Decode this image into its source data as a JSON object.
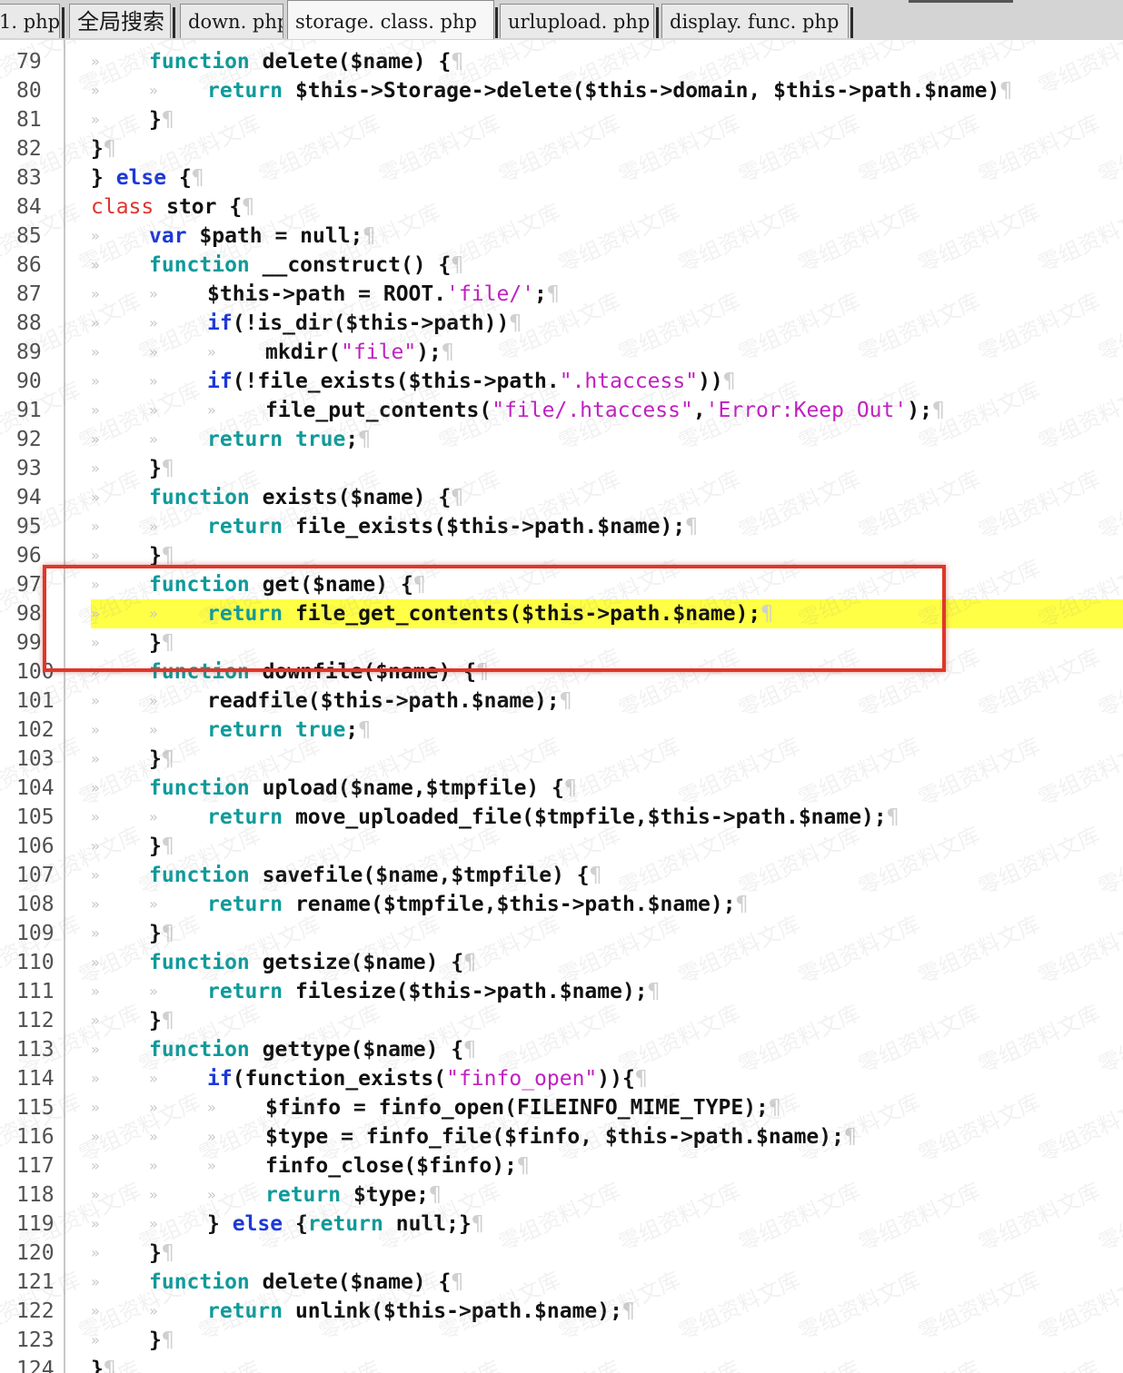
{
  "tabs": [
    {
      "label": "1. php",
      "active": false
    },
    {
      "label": "全局搜索",
      "active": false
    },
    {
      "label": "down. php",
      "active": false
    },
    {
      "label": "storage. class. php",
      "active": true
    },
    {
      "label": "urlupload. php",
      "active": false
    },
    {
      "label": "display. func. php",
      "active": false
    }
  ],
  "editor": {
    "highlighted_line": 98,
    "lines": [
      {
        "n": "79",
        "indent": 1,
        "tokens": [
          [
            "fn-kw",
            "function "
          ],
          [
            "plain",
            "delete($name) {"
          ]
        ]
      },
      {
        "n": "80",
        "indent": 2,
        "tokens": [
          [
            "fn-kw",
            "return "
          ],
          [
            "plain",
            "$this->Storage->delete($this->domain, $this->path.$name)"
          ]
        ]
      },
      {
        "n": "81",
        "indent": 1,
        "tokens": [
          [
            "plain",
            "}"
          ]
        ]
      },
      {
        "n": "82",
        "indent": 0,
        "tokens": [
          [
            "plain",
            "}"
          ]
        ]
      },
      {
        "n": "83",
        "indent": 0,
        "tokens": [
          [
            "plain",
            "} "
          ],
          [
            "kw",
            "else"
          ],
          [
            "plain",
            " {"
          ]
        ]
      },
      {
        "n": "84",
        "indent": 0,
        "tokens": [
          [
            "cls",
            "class"
          ],
          [
            "plain",
            " stor {"
          ]
        ]
      },
      {
        "n": "85",
        "indent": 1,
        "tokens": [
          [
            "kw",
            "var"
          ],
          [
            "plain",
            " $path = null;"
          ]
        ]
      },
      {
        "n": "86",
        "indent": 1,
        "tokens": [
          [
            "fn-kw",
            "function "
          ],
          [
            "plain",
            "__construct() {"
          ]
        ]
      },
      {
        "n": "87",
        "indent": 2,
        "tokens": [
          [
            "plain",
            "$this->path = ROOT."
          ],
          [
            "str",
            "'file/'"
          ],
          [
            "plain",
            ";"
          ]
        ]
      },
      {
        "n": "88",
        "indent": 2,
        "tokens": [
          [
            "kw",
            "if"
          ],
          [
            "plain",
            "(!is_dir($this->path))"
          ]
        ]
      },
      {
        "n": "89",
        "indent": 3,
        "tokens": [
          [
            "plain",
            "mkdir("
          ],
          [
            "str",
            "\"file\""
          ],
          [
            "plain",
            ");"
          ]
        ]
      },
      {
        "n": "90",
        "indent": 2,
        "tokens": [
          [
            "kw",
            "if"
          ],
          [
            "plain",
            "(!file_exists($this->path."
          ],
          [
            "str",
            "\".htaccess\""
          ],
          [
            "plain",
            "))"
          ]
        ]
      },
      {
        "n": "91",
        "indent": 3,
        "tokens": [
          [
            "plain",
            "file_put_contents("
          ],
          [
            "str",
            "\"file/.htaccess\""
          ],
          [
            "plain",
            ","
          ],
          [
            "str",
            "'Error:Keep Out'"
          ],
          [
            "plain",
            ");"
          ]
        ]
      },
      {
        "n": "92",
        "indent": 2,
        "tokens": [
          [
            "fn-kw",
            "return "
          ],
          [
            "fn-kw",
            "true"
          ],
          [
            "plain",
            ";"
          ]
        ]
      },
      {
        "n": "93",
        "indent": 1,
        "tokens": [
          [
            "plain",
            "}"
          ]
        ]
      },
      {
        "n": "94",
        "indent": 1,
        "tokens": [
          [
            "fn-kw",
            "function "
          ],
          [
            "plain",
            "exists($name) {"
          ]
        ]
      },
      {
        "n": "95",
        "indent": 2,
        "tokens": [
          [
            "fn-kw",
            "return "
          ],
          [
            "plain",
            "file_exists($this->path.$name);"
          ]
        ]
      },
      {
        "n": "96",
        "indent": 1,
        "tokens": [
          [
            "plain",
            "}"
          ]
        ]
      },
      {
        "n": "97",
        "indent": 1,
        "tokens": [
          [
            "fn-kw",
            "function "
          ],
          [
            "plain",
            "get($name) {"
          ]
        ]
      },
      {
        "n": "98",
        "indent": 2,
        "tokens": [
          [
            "fn-kw",
            "return "
          ],
          [
            "plain",
            "file_get_contents($this->path.$name);"
          ]
        ]
      },
      {
        "n": "99",
        "indent": 1,
        "tokens": [
          [
            "plain",
            "}"
          ]
        ]
      },
      {
        "n": "100",
        "indent": 1,
        "tokens": [
          [
            "fn-kw",
            "function "
          ],
          [
            "plain",
            "downfile($name) {"
          ]
        ]
      },
      {
        "n": "101",
        "indent": 2,
        "tokens": [
          [
            "plain",
            "readfile($this->path.$name);"
          ]
        ]
      },
      {
        "n": "102",
        "indent": 2,
        "tokens": [
          [
            "fn-kw",
            "return "
          ],
          [
            "fn-kw",
            "true"
          ],
          [
            "plain",
            ";"
          ]
        ]
      },
      {
        "n": "103",
        "indent": 1,
        "tokens": [
          [
            "plain",
            "}"
          ]
        ]
      },
      {
        "n": "104",
        "indent": 1,
        "tokens": [
          [
            "fn-kw",
            "function "
          ],
          [
            "plain",
            "upload($name,$tmpfile) {"
          ]
        ]
      },
      {
        "n": "105",
        "indent": 2,
        "tokens": [
          [
            "fn-kw",
            "return "
          ],
          [
            "plain",
            "move_uploaded_file($tmpfile,$this->path.$name);"
          ]
        ]
      },
      {
        "n": "106",
        "indent": 1,
        "tokens": [
          [
            "plain",
            "}"
          ]
        ]
      },
      {
        "n": "107",
        "indent": 1,
        "tokens": [
          [
            "fn-kw",
            "function "
          ],
          [
            "plain",
            "savefile($name,$tmpfile) {"
          ]
        ]
      },
      {
        "n": "108",
        "indent": 2,
        "tokens": [
          [
            "fn-kw",
            "return "
          ],
          [
            "plain",
            "rename($tmpfile,$this->path.$name);"
          ]
        ]
      },
      {
        "n": "109",
        "indent": 1,
        "tokens": [
          [
            "plain",
            "}"
          ]
        ]
      },
      {
        "n": "110",
        "indent": 1,
        "tokens": [
          [
            "fn-kw",
            "function "
          ],
          [
            "plain",
            "getsize($name) {"
          ]
        ]
      },
      {
        "n": "111",
        "indent": 2,
        "tokens": [
          [
            "fn-kw",
            "return "
          ],
          [
            "plain",
            "filesize($this->path.$name);"
          ]
        ]
      },
      {
        "n": "112",
        "indent": 1,
        "tokens": [
          [
            "plain",
            "}"
          ]
        ]
      },
      {
        "n": "113",
        "indent": 1,
        "tokens": [
          [
            "fn-kw",
            "function "
          ],
          [
            "plain",
            "gettype($name) {"
          ]
        ]
      },
      {
        "n": "114",
        "indent": 2,
        "tokens": [
          [
            "kw",
            "if"
          ],
          [
            "plain",
            "(function_exists("
          ],
          [
            "str",
            "\"finfo_open\""
          ],
          [
            "plain",
            ")){"
          ]
        ]
      },
      {
        "n": "115",
        "indent": 3,
        "tokens": [
          [
            "plain",
            "$finfo = finfo_open(FILEINFO_MIME_TYPE);"
          ]
        ]
      },
      {
        "n": "116",
        "indent": 3,
        "tokens": [
          [
            "plain",
            "$type = finfo_file($finfo, $this->path.$name);"
          ]
        ]
      },
      {
        "n": "117",
        "indent": 3,
        "tokens": [
          [
            "plain",
            "finfo_close($finfo);"
          ]
        ]
      },
      {
        "n": "118",
        "indent": 3,
        "tokens": [
          [
            "fn-kw",
            "return "
          ],
          [
            "plain",
            "$type;"
          ]
        ]
      },
      {
        "n": "119",
        "indent": 2,
        "tokens": [
          [
            "plain",
            "} "
          ],
          [
            "kw",
            "else"
          ],
          [
            "plain",
            " {"
          ],
          [
            "fn-kw",
            "return "
          ],
          [
            "plain",
            "null;}"
          ]
        ]
      },
      {
        "n": "120",
        "indent": 1,
        "tokens": [
          [
            "plain",
            "}"
          ]
        ]
      },
      {
        "n": "121",
        "indent": 1,
        "tokens": [
          [
            "fn-kw",
            "function "
          ],
          [
            "plain",
            "delete($name) {"
          ]
        ]
      },
      {
        "n": "122",
        "indent": 2,
        "tokens": [
          [
            "fn-kw",
            "return "
          ],
          [
            "plain",
            "unlink($this->path.$name);"
          ]
        ]
      },
      {
        "n": "123",
        "indent": 1,
        "tokens": [
          [
            "plain",
            "}"
          ]
        ]
      },
      {
        "n": "124",
        "indent": 0,
        "tokens": [
          [
            "plain",
            "}"
          ]
        ]
      }
    ]
  },
  "watermark_text": "零组资料文库",
  "colors": {
    "function_keyword": "#0f9a9a",
    "keyword": "#1c39d8",
    "class_keyword": "#e0332f",
    "string": "#c020c0",
    "line_highlight": "#ffff45",
    "annotation_box": "#e0362b"
  }
}
